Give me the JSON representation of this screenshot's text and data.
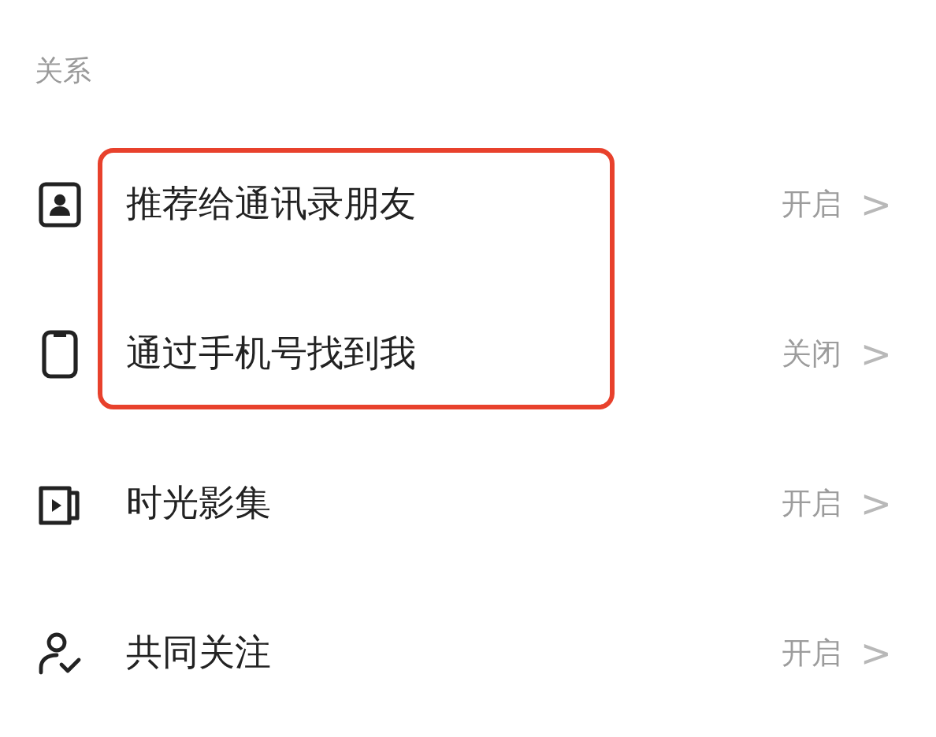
{
  "section": {
    "title": "关系"
  },
  "rows": [
    {
      "label": "推荐给通讯录朋友",
      "value": "开启",
      "chevron": ">",
      "highlighted": true
    },
    {
      "label": "通过手机号找到我",
      "value": "关闭",
      "chevron": ">",
      "highlighted": true
    },
    {
      "label": "时光影集",
      "value": "开启",
      "chevron": ">",
      "highlighted": false
    },
    {
      "label": "共同关注",
      "value": "开启",
      "chevron": ">",
      "highlighted": false
    }
  ]
}
